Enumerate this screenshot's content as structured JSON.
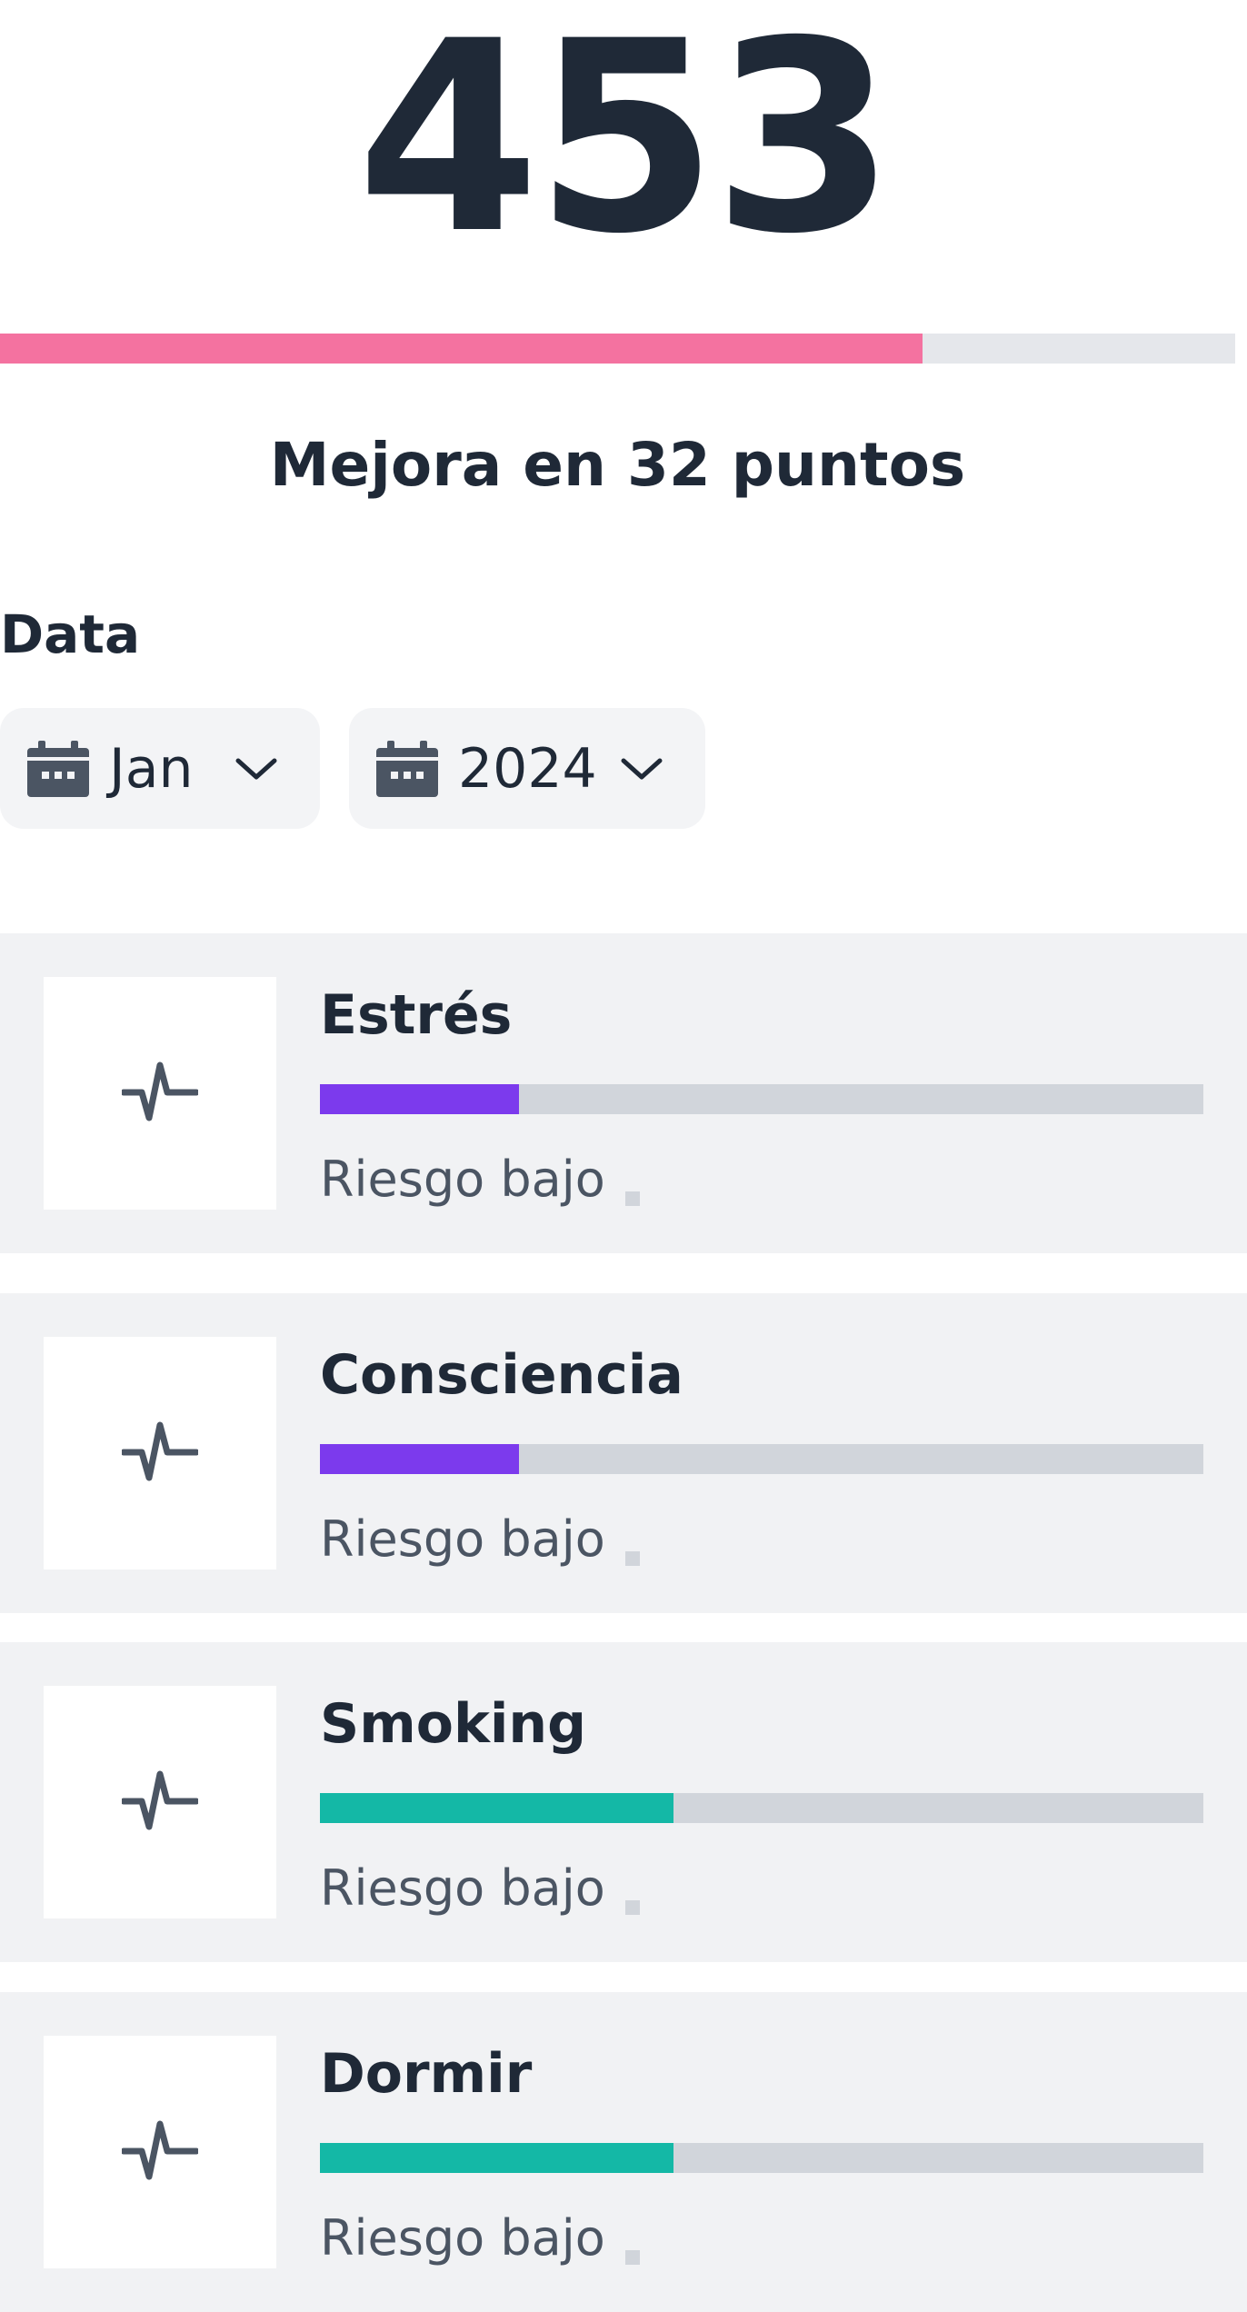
{
  "score": {
    "value": "453",
    "progress_fraction": 0.747,
    "progress_color": "#f472a0",
    "improvement_text": "Mejora en 32 puntos"
  },
  "date_filter": {
    "label": "Data",
    "month": "Jan",
    "year": "2024",
    "calendar_icon": "calendar-icon",
    "dropdown_icon": "chevron-down-icon"
  },
  "metrics": [
    {
      "name": "Estrés",
      "progress_fraction": 0.225,
      "color": "#7c3aed",
      "status": "Riesgo bajo",
      "icon": "pulse-icon"
    },
    {
      "name": "Consciencia",
      "progress_fraction": 0.225,
      "color": "#7c3aed",
      "status": "Riesgo bajo",
      "icon": "pulse-icon"
    },
    {
      "name": "Smoking",
      "progress_fraction": 0.4,
      "color": "#14b8a6",
      "status": "Riesgo bajo",
      "icon": "pulse-icon"
    },
    {
      "name": "Dormir",
      "progress_fraction": 0.4,
      "color": "#14b8a6",
      "status": "Riesgo bajo",
      "icon": "pulse-icon"
    }
  ]
}
